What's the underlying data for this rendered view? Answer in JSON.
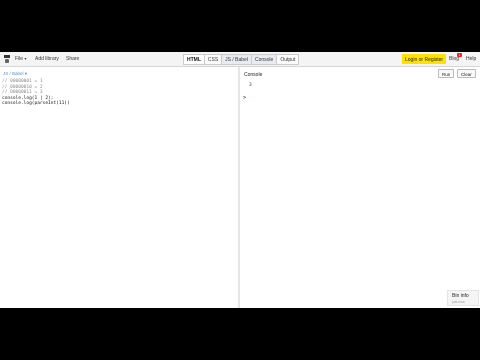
{
  "toolbar": {
    "file": "File",
    "add_library": "Add library",
    "share": "Share",
    "panels": [
      "HTML",
      "CSS",
      "JS / Babel",
      "Console",
      "Output"
    ],
    "login": "Login or Register",
    "blog": "Blog",
    "blog_badge": "1",
    "help": "Help"
  },
  "editor": {
    "language_label": "JS / Babel ▾",
    "lines": [
      "// 00000001 = 1",
      "// 00000010 = 2",
      "// 00000011 = 3",
      "console.log(1 | 2);",
      "console.log(parseInt(11))"
    ]
  },
  "console": {
    "title": "Console",
    "run_label": "Run",
    "clear_label": "Clear",
    "output": [
      "3"
    ],
    "prompt": ">"
  },
  "bin_info": {
    "title": "Bin info",
    "subtitle": "just now"
  },
  "colors": {
    "login_bg": "#ffe100",
    "js_label": "#5a8ec8",
    "comment": "#8a8a8a",
    "prompt": "#2b5a9c"
  }
}
